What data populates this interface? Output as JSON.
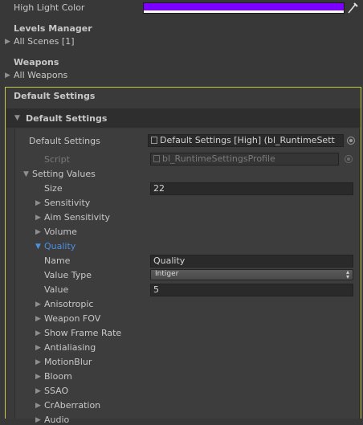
{
  "top": {
    "high_light_label": "High Light Color",
    "high_light_color": "#7b00ff"
  },
  "levels": {
    "header": "Levels Manager",
    "item": "All Scenes [1]"
  },
  "weapons": {
    "header": "Weapons",
    "item": "All Weapons"
  },
  "settings": {
    "section_title": "Default Settings",
    "foldout_title": "Default Settings",
    "ref_label": "Default Settings",
    "ref_value": "Default Settings [High] (bl_RuntimeSett",
    "script_label": "Script",
    "script_value": "bl_RuntimeSettingsProfile",
    "values_label": "Setting Values",
    "size_label": "Size",
    "size_value": "22",
    "items_before": [
      "Sensitivity",
      "Aim Sensitivity",
      "Volume"
    ],
    "quality": {
      "label": "Quality",
      "name_label": "Name",
      "name_value": "Quality",
      "type_label": "Value Type",
      "type_value": "Intiger",
      "value_label": "Value",
      "value_value": "5"
    },
    "items_after": [
      "Anisotropic",
      "Weapon FOV",
      "Show Frame Rate",
      "Antialiasing",
      "MotionBlur",
      "Bloom",
      "SSAO",
      "CrAberration",
      "Audio"
    ]
  },
  "colors": {
    "highlight_border": "#c8c846",
    "accent_blue": "#4d8fe0"
  }
}
